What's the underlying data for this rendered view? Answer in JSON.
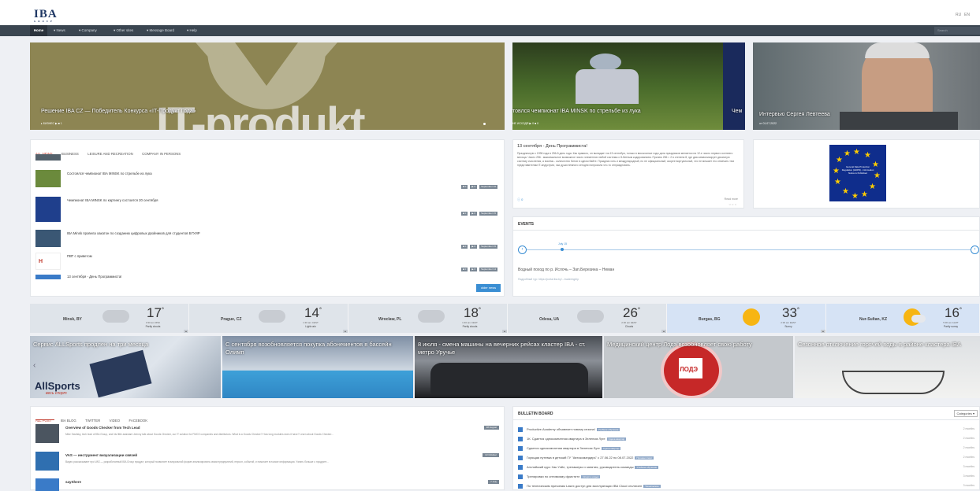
{
  "header": {
    "logo": "IBA",
    "logo_sub": "GROUP",
    "lang_ru": "RU",
    "lang_en": "EN"
  },
  "nav": {
    "items": [
      "Home",
      "▾ News",
      "▾ Company",
      "▾ Other sites",
      "▾ Message Board",
      "▾ Help"
    ],
    "search_placeholder": "Search"
  },
  "heroes": [
    {
      "caption": "Решение IBA CZ — Победитель Конкурса «IT-Продукт Года»",
      "meta": "▸ БИЗНЕС  ▶ ■ 1",
      "big_text": "IT-produkt"
    },
    {
      "caption": "товлся чемпионат IBA MINSK по стрельбе из лука",
      "meta": "НЕ ИСХОДЯ ▶ 0 ■ 0"
    },
    {
      "caption": "Интервью Сергея Левтеева",
      "meta": "от 01.07.2022",
      "edge_caption": "Чем"
    }
  ],
  "news": {
    "tabs": [
      "ALL NEWS",
      "BUSINESS",
      "LEISURE AND RECREATION",
      "COMPANY IN PERSONS"
    ],
    "items": [
      {
        "title": "Состоялся чемпионат IBA MINSK по стрельбе из лука",
        "date": "September 16"
      },
      {
        "title": "Чемпионат IBA MINSK по картингу состоится 20 сентября",
        "date": "September 15"
      },
      {
        "title": "IBA Minsk провела хакатон по созданию цифровых двойников для студентов БГУИР",
        "date": "September 15"
      },
      {
        "title": "ПВТ с приветом",
        "date": "September 14"
      },
      {
        "title": "13 сентября - День Программиста!",
        "date": ""
      }
    ],
    "more_button": "older news"
  },
  "feature": {
    "title": "13 сентября - День Программиста!",
    "body": "Праздничную с 1996 года в 256-й день года. Как правило, он выпадает на 13 сентября, только в високосные годы дата праздников меняется на 12-е число первого осеннего месяца. Число 256 - максимальное возможное число элементов любой системы с 8-битным кодированием. Причем 256 = 2 в степени 8, где два символизирует двоичную систему счисления, а восемь - количество битов в одном байте. Праздник хоть и международный, но не официальный, скорее виртуальный, что не мешает его отмечать тем представителям IT-индустрии, чьи души немного сегодня попросила что-то отпраздновать.",
    "comments": "ⓘ 0",
    "read_more": "Read more"
  },
  "eu_banner": {
    "text": "General Data Protection Regulation (GDPR) - Information Notice is Published"
  },
  "events": {
    "heading": "EVENTS",
    "date": "July 15",
    "title": "Водный поход по р. Ислочь – Зап.Березина – Неман",
    "desc": "Подробный тур: https://portal.iba.by/.../wateringtrip"
  },
  "weather": [
    {
      "city": "Minsk, BY",
      "temp": "17",
      "time": "3:30 am MSK",
      "cond": "Partly clouds"
    },
    {
      "city": "Prague, CZ",
      "temp": "14",
      "time": "1:30 am CEST",
      "cond": "Light rain"
    },
    {
      "city": "Wroclaw, PL",
      "temp": "18",
      "time": "1:30 am CEST",
      "cond": "Partly clouds"
    },
    {
      "city": "Odesa, UA",
      "temp": "26",
      "time": "2:30 am EEST",
      "cond": "Clouds"
    },
    {
      "city": "Burgas, BG",
      "temp": "33",
      "time": "2:30 am EEST",
      "cond": "Sunny"
    },
    {
      "city": "Nur-Sultan, KZ",
      "temp": "16",
      "time": "5:30 am ALMT",
      "cond": "Partly sunny"
    }
  ],
  "slides": [
    {
      "caption": "Сервис ALLSports продлен на три месяца",
      "brand": "AllSports",
      "brand_sub": "весь спорт"
    },
    {
      "caption": "С сентября возобновляется покупка абонементов в бассейн Олимп"
    },
    {
      "caption": "8 июля - смена машины на вечерних рейсах кластер IBA - ст. метро Уручье"
    },
    {
      "caption": "Медицинский центр Лодэ возобновляет свою работу",
      "badge": "ЛОДЭ"
    },
    {
      "caption": "Сезонное отключение горячей воды в районе кластера IBA"
    }
  ],
  "posts": {
    "tabs": [
      "ALL POST",
      "IBA BLOG",
      "TWITTER",
      "VIDEO",
      "FACEBOOK"
    ],
    "items": [
      {
        "title": "Overview of Goods Checker from Tech Lead",
        "desc": "Mike Savitsky, tech lead of IBA Group, and his little assistant Johnny talk about Goods Checker, our IT solution for FMCG companies and distributors. What is a Goods Checker? How long modules does it have? Learn about Goods Checker...",
        "date": "18 August"
      },
      {
        "title": "VAS — инструмент визуализации связей",
        "desc": "Видео рассказывает про VAS — разработанный IBA Group продукт, который позволяет в визуальной форме анализировать связи предприятий, персон, событий, и помогает в поиске информации. Узнать больше о продукте...",
        "date": "13 October"
      },
      {
        "title": "sayShere",
        "desc": "",
        "date": "7 July"
      }
    ]
  },
  "bulletin": {
    "heading": "BULLETIN BOARD",
    "category_button": "Categories ▾",
    "items": [
      {
        "text": "Productive.Academy объявляет новому сезона!",
        "tag": "Учебное обучение",
        "ago": "2 months"
      },
      {
        "text": "1К. Сдается однокомнатная квартира в Зеленом Луге",
        "tag": "Сдача квартир",
        "ago": "2 months"
      },
      {
        "text": "Сдается однокомнатная квартира в Зеленом Луге",
        "tag": "Сдача квартир",
        "ago": "2 months"
      },
      {
        "text": "Горящая путевка в детский ГУ \"Автокомандирь\" с 27.06.22 по 08.07.2022",
        "tag": "Путевки спорт",
        "ago": "2 months"
      },
      {
        "text": "Английский курс Хак Уэйл, тренажеры и занятия, руководитель команды",
        "tag": "Учебное обучение",
        "ago": "3 months"
      },
      {
        "text": "Тренировки по оптимизму фриститл",
        "tag": "Спорт и отдых",
        "ago": "3 months"
      },
      {
        "text": "По техническим причинам Lasex доступ для эксплуатации IBA Cloud отключен",
        "tag": "Техническое",
        "ago": "3 months"
      }
    ]
  },
  "colors": {
    "nav_bg": "#3b4651",
    "accent_red": "#c0392b",
    "accent_blue": "#3a8ed3"
  }
}
